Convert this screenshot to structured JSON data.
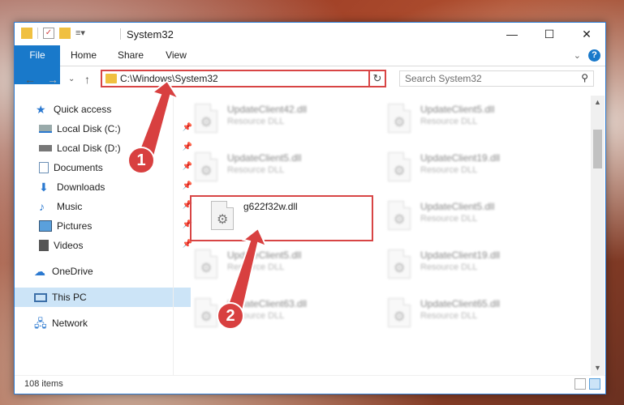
{
  "window": {
    "title": "System32"
  },
  "ribbon": {
    "tabs": [
      "File",
      "Home",
      "Share",
      "View"
    ],
    "help": "?"
  },
  "address": {
    "path": "C:\\Windows\\System32"
  },
  "search": {
    "placeholder": "Search System32"
  },
  "sidebar": {
    "items": [
      {
        "label": "Quick access",
        "icon": "star-icon",
        "pinned": false
      },
      {
        "label": "Local Disk (C:)",
        "icon": "disk-icon",
        "pinned": true
      },
      {
        "label": "Local Disk (D:)",
        "icon": "disk-icon",
        "pinned": true
      },
      {
        "label": "Documents",
        "icon": "documents-icon",
        "pinned": true
      },
      {
        "label": "Downloads",
        "icon": "download-arrow-icon",
        "pinned": true
      },
      {
        "label": "Music",
        "icon": "music-note-icon",
        "pinned": true
      },
      {
        "label": "Pictures",
        "icon": "pictures-icon",
        "pinned": true
      },
      {
        "label": "Videos",
        "icon": "video-icon",
        "pinned": true
      },
      {
        "label": "OneDrive",
        "icon": "cloud-icon",
        "pinned": false
      },
      {
        "label": "This PC",
        "icon": "computer-icon",
        "pinned": false
      },
      {
        "label": "Network",
        "icon": "network-icon",
        "pinned": false
      }
    ]
  },
  "files": [
    {
      "name": "UpdateClient42.dll",
      "type": "Resource DLL",
      "blurred": true
    },
    {
      "name": "UpdateClient5.dll",
      "type": "Resource DLL",
      "blurred": true
    },
    {
      "name": "UpdateClient5.dll",
      "type": "Resource DLL",
      "blurred": true
    },
    {
      "name": "UpdateClient19.dll",
      "type": "Resource DLL",
      "blurred": true
    },
    {
      "name": "g622f32w.dll",
      "type": "",
      "blurred": false
    },
    {
      "name": "UpdateClient5.dll",
      "type": "Resource DLL",
      "blurred": true
    },
    {
      "name": "UpdateClient5.dll",
      "type": "Resource DLL",
      "blurred": true
    },
    {
      "name": "UpdateClient19.dll",
      "type": "Resource DLL",
      "blurred": true
    },
    {
      "name": "UpdateClient63.dll",
      "type": "Resource DLL",
      "blurred": true
    },
    {
      "name": "UpdateClient65.dll",
      "type": "Resource DLL",
      "blurred": true
    }
  ],
  "status": {
    "count": "108 items"
  },
  "callouts": [
    "1",
    "2"
  ],
  "colors": {
    "accent": "#1979ca",
    "highlight": "#d84545"
  }
}
